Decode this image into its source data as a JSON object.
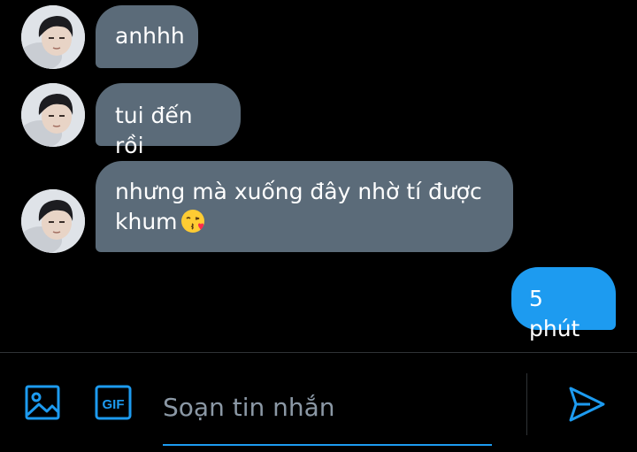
{
  "conversation": {
    "messages": [
      {
        "side": "incoming",
        "text": "anhhh"
      },
      {
        "side": "incoming",
        "text": "tui đến rồi"
      },
      {
        "side": "incoming",
        "line1": "nhưng mà xuống đây nhờ tí được",
        "line2": "khum",
        "emoji": "face-blowing-kiss"
      },
      {
        "side": "outgoing",
        "text": "5 phút"
      }
    ]
  },
  "composer": {
    "placeholder": "Soạn tin nhắn",
    "value": "",
    "image_icon": "image-icon",
    "gif_label": "GIF",
    "send_icon": "send-icon"
  },
  "colors": {
    "background": "#000000",
    "incoming_bubble": "#5b6b79",
    "outgoing_bubble": "#1d9bf0",
    "accent": "#1d9bf0",
    "placeholder": "#8b98a5"
  }
}
